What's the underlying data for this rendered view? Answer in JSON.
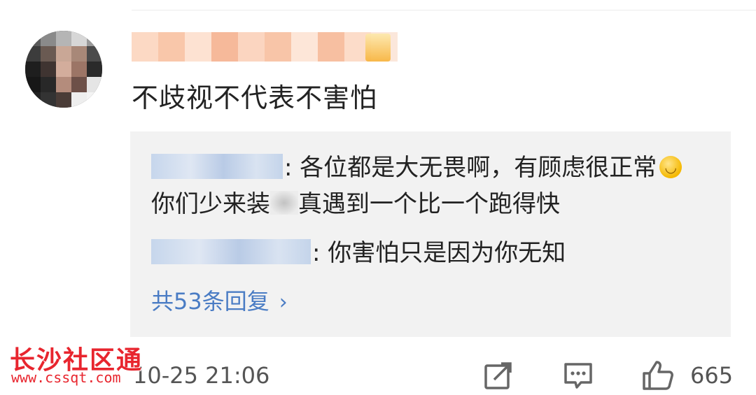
{
  "comment": {
    "text": "不歧视不代表不害怕"
  },
  "replies": [
    {
      "text_part1": ": 各位都是大无畏啊，有顾虑很正常",
      "text_part2": " 你们少来装",
      "text_part3": "真遇到一个比一个跑得快"
    },
    {
      "text": ": 你害怕只是因为你无知"
    }
  ],
  "more_replies": {
    "label": "共53条回复",
    "chevron": "›"
  },
  "footer": {
    "timestamp": "10-25 21:06",
    "like_count": "665"
  },
  "watermark": {
    "brand": "长沙社区通",
    "url": "www.cssqt.com"
  },
  "icons": {
    "repost": "repost-icon",
    "comment": "comment-icon",
    "like": "thumbs-up-icon",
    "emoji": "grinning-emoji"
  },
  "colors": {
    "link": "#4a7cc4",
    "reply_bg": "#f2f2f2",
    "watermark": "#e8252e"
  }
}
